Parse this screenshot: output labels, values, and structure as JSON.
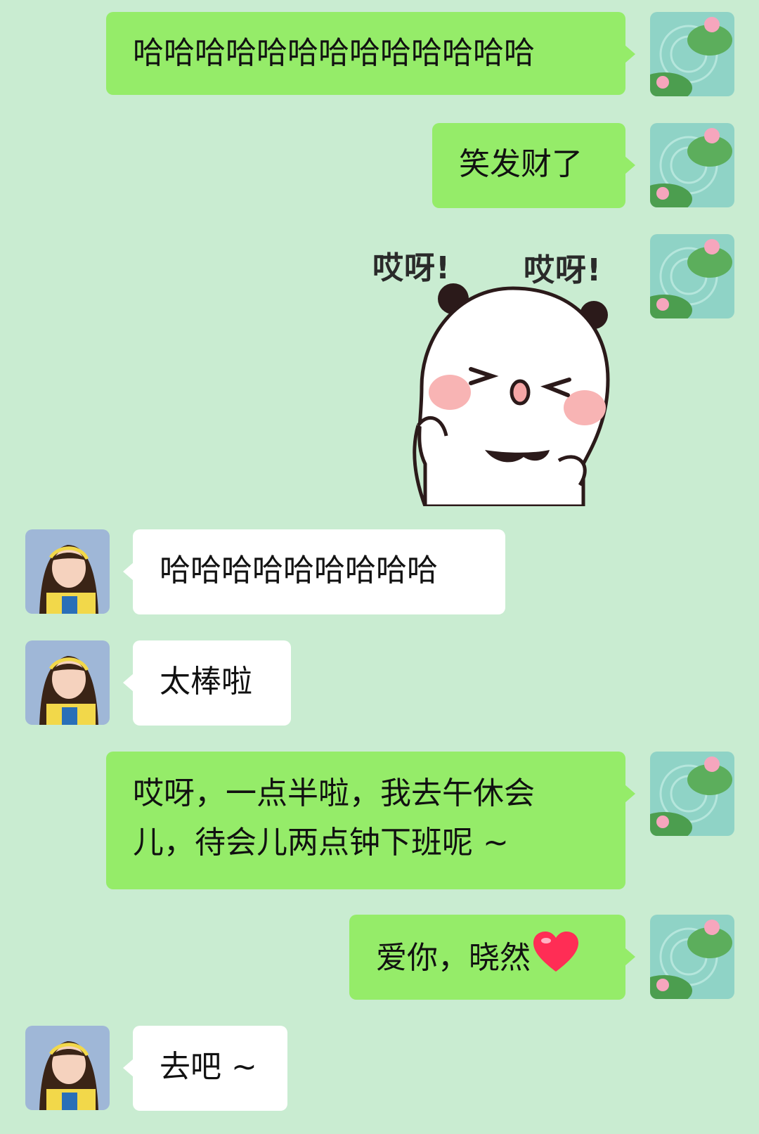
{
  "chat": {
    "messages": [
      {
        "sender": "me",
        "type": "text",
        "text": "哈哈哈哈哈哈哈哈哈哈哈哈哈"
      },
      {
        "sender": "me",
        "type": "text",
        "text": "笑发财了"
      },
      {
        "sender": "me",
        "type": "sticker",
        "sticker_name": "panda-sticker",
        "caption_left": "哎呀!",
        "caption_right": "哎呀!"
      },
      {
        "sender": "them",
        "type": "text",
        "text": "哈哈哈哈哈哈哈哈哈"
      },
      {
        "sender": "them",
        "type": "text",
        "text": "太棒啦"
      },
      {
        "sender": "me",
        "type": "text",
        "line1": "哎呀，一点半啦，我去午休会",
        "line2": "儿，待会儿两点钟下班呢 ~"
      },
      {
        "sender": "me",
        "type": "text",
        "text": "爱你，晓然",
        "emoji": "heart-icon"
      },
      {
        "sender": "them",
        "type": "text",
        "text": "去吧 ~"
      }
    ]
  },
  "colors": {
    "background": "#c9ecd1",
    "my_bubble": "#95ec69",
    "their_bubble": "#ffffff",
    "text": "#111111",
    "heart": "#ff2d55"
  }
}
